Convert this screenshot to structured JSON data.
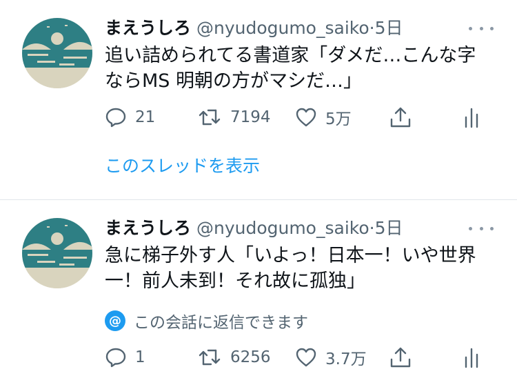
{
  "tweets": [
    {
      "user": {
        "name": "まえうしろ",
        "handle": "@nyudogumo_saiko"
      },
      "separator": "·",
      "time": "5日",
      "text_lines": [
        "追い詰められてる書道家「ダメだ…こんな字",
        "ならMS 明朝の方がマシだ…」"
      ],
      "replies": "21",
      "retweets": "7194",
      "likes": "5万",
      "thread_link": "このスレッドを表示"
    },
    {
      "user": {
        "name": "まえうしろ",
        "handle": "@nyudogumo_saiko"
      },
      "separator": "·",
      "time": "5日",
      "text_lines": [
        "急に梯子外す人「いよっ！日本一！いや世界",
        "一！前人未到！それ故に孤独」"
      ],
      "reply_note": "この会話に返信できます",
      "reply_badge": "@",
      "replies": "1",
      "retweets": "6256",
      "likes": "3.7万"
    }
  ],
  "colors": {
    "accent": "#1d9bf0",
    "secondary": "#536471",
    "divider": "#e1e6ea"
  },
  "icons": [
    "more-icon",
    "reply-icon",
    "retweet-icon",
    "like-icon",
    "share-icon",
    "stats-icon",
    "mention-icon"
  ]
}
